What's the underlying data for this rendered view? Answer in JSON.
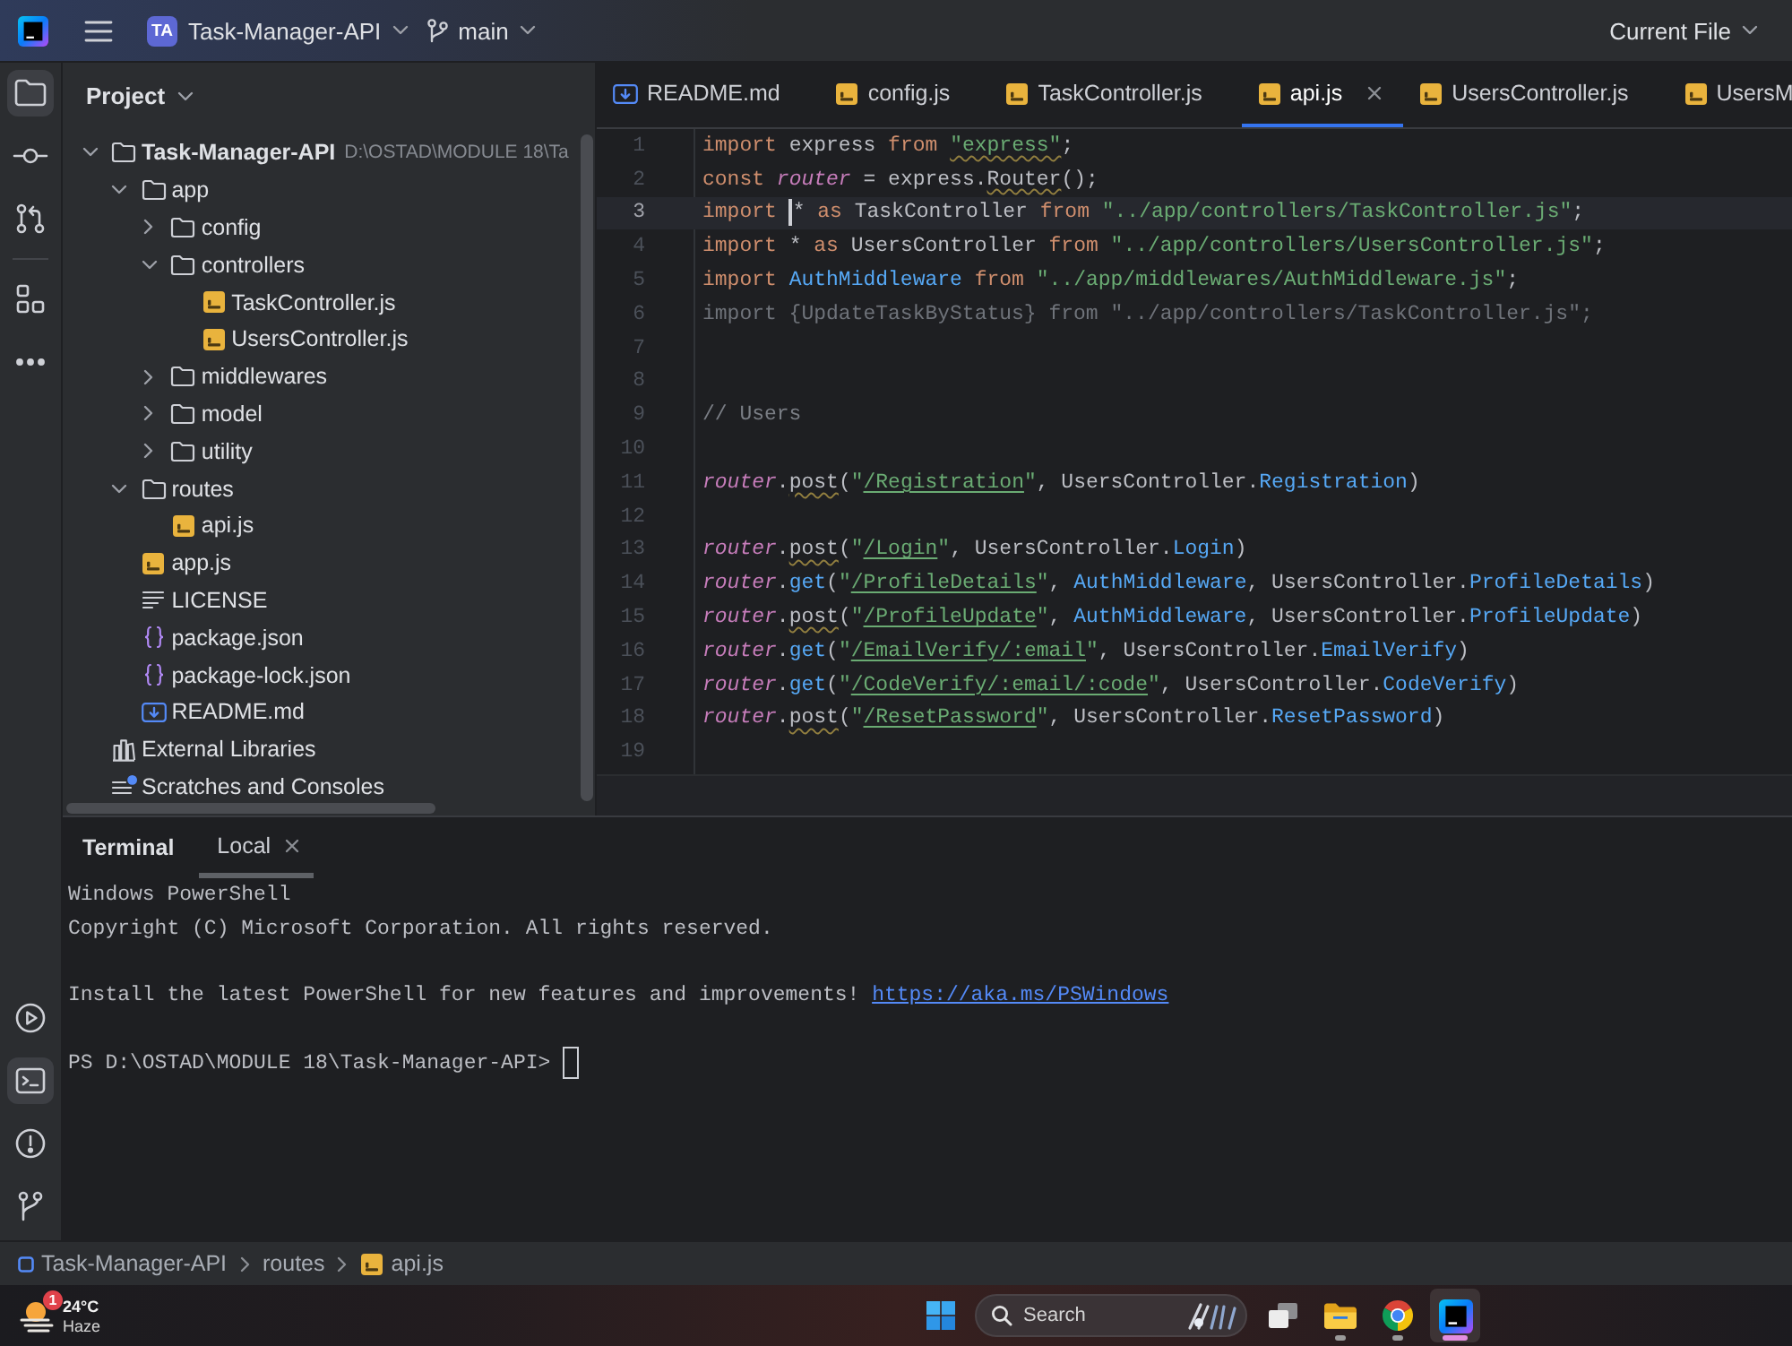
{
  "title_bar": {
    "project_badge": "TA",
    "project": "Task-Manager-API",
    "branch": "main",
    "run_config": "Current File"
  },
  "tool_strip": {
    "top_groups": [
      {
        "buttons": [
          {
            "kind": "project",
            "selected": true
          },
          {
            "kind": "commit",
            "selected": false
          },
          {
            "kind": "pull_requests",
            "selected": false
          }
        ]
      },
      {
        "buttons": [
          {
            "kind": "structure",
            "selected": false
          },
          {
            "kind": "more",
            "selected": false
          }
        ]
      }
    ],
    "bottom": [
      {
        "kind": "services",
        "selected": false
      },
      {
        "kind": "terminal",
        "selected": true
      },
      {
        "kind": "problems",
        "selected": false
      },
      {
        "kind": "git",
        "selected": false
      }
    ]
  },
  "project_panel": {
    "title": "Project",
    "tree": [
      {
        "name": "Task-Manager-API",
        "kind": "project",
        "path": "D:\\OSTAD\\MODULE 18\\Ta",
        "expanded": true,
        "children": [
          {
            "name": "app",
            "kind": "folder",
            "expanded": true,
            "children": [
              {
                "name": "config",
                "kind": "folder",
                "expanded": false
              },
              {
                "name": "controllers",
                "kind": "folder",
                "expanded": true,
                "children": [
                  {
                    "name": "TaskController.js",
                    "kind": "js"
                  },
                  {
                    "name": "UsersController.js",
                    "kind": "js"
                  }
                ]
              },
              {
                "name": "middlewares",
                "kind": "folder",
                "expanded": false
              },
              {
                "name": "model",
                "kind": "folder",
                "expanded": false
              },
              {
                "name": "utility",
                "kind": "folder",
                "expanded": false
              }
            ]
          },
          {
            "name": "routes",
            "kind": "folder",
            "expanded": true,
            "children": [
              {
                "name": "api.js",
                "kind": "js"
              }
            ]
          },
          {
            "name": "app.js",
            "kind": "js"
          },
          {
            "name": "LICENSE",
            "kind": "text"
          },
          {
            "name": "package.json",
            "kind": "json"
          },
          {
            "name": "package-lock.json",
            "kind": "json"
          },
          {
            "name": "README.md",
            "kind": "markdown"
          }
        ]
      },
      {
        "name": "External Libraries",
        "kind": "libraries"
      },
      {
        "name": "Scratches and Consoles",
        "kind": "scratches"
      }
    ]
  },
  "editor": {
    "tabs": [
      {
        "label": "README.md",
        "kind": "markdown",
        "selected": false
      },
      {
        "label": "config.js",
        "kind": "js",
        "selected": false
      },
      {
        "label": "TaskController.js",
        "kind": "js",
        "selected": false
      },
      {
        "label": "api.js",
        "kind": "js",
        "selected": true
      },
      {
        "label": "UsersController.js",
        "kind": "js",
        "selected": false
      },
      {
        "label": "UsersM",
        "kind": "js",
        "selected": false
      }
    ],
    "lines": [
      {
        "number": "1",
        "current": false,
        "tokens": [
          {
            "text": "import",
            "kind": "keyword",
            "typo": false
          },
          {
            "text": " express ",
            "kind": "plain",
            "typo": false
          },
          {
            "text": "from ",
            "kind": "keyword",
            "typo": false
          },
          {
            "text": "\"express\"",
            "kind": "string",
            "typo": true
          },
          {
            "text": ";",
            "kind": "plain",
            "typo": false
          }
        ]
      },
      {
        "number": "2",
        "current": false,
        "tokens": [
          {
            "text": "const ",
            "kind": "keyword",
            "typo": false
          },
          {
            "text": "router",
            "kind": "field",
            "typo": false
          },
          {
            "text": " = express.",
            "kind": "plain",
            "typo": false
          },
          {
            "text": "Router",
            "kind": "plain",
            "typo": true
          },
          {
            "text": "();",
            "kind": "plain",
            "typo": false
          }
        ]
      },
      {
        "number": "3",
        "current": true,
        "tokens": [
          {
            "text": "import ",
            "kind": "keyword",
            "typo": false
          },
          {
            "kind": "caret"
          },
          {
            "text": "* ",
            "kind": "plain",
            "typo": false
          },
          {
            "text": "as",
            "kind": "keyword",
            "typo": false
          },
          {
            "text": " TaskController ",
            "kind": "plain",
            "typo": false
          },
          {
            "text": "from ",
            "kind": "keyword",
            "typo": false
          },
          {
            "text": "\"../app/controllers/TaskController.js\"",
            "kind": "string",
            "typo": false
          },
          {
            "text": ";",
            "kind": "plain",
            "typo": false
          }
        ]
      },
      {
        "number": "4",
        "current": false,
        "tokens": [
          {
            "text": "import",
            "kind": "keyword",
            "typo": false
          },
          {
            "text": " * ",
            "kind": "plain",
            "typo": false
          },
          {
            "text": "as",
            "kind": "keyword",
            "typo": false
          },
          {
            "text": " UsersController ",
            "kind": "plain",
            "typo": false
          },
          {
            "text": "from ",
            "kind": "keyword",
            "typo": false
          },
          {
            "text": "\"../app/controllers/UsersController.js\"",
            "kind": "string",
            "typo": false
          },
          {
            "text": ";",
            "kind": "plain",
            "typo": false
          }
        ]
      },
      {
        "number": "5",
        "current": false,
        "tokens": [
          {
            "text": "import ",
            "kind": "keyword",
            "typo": false
          },
          {
            "text": "AuthMiddleware",
            "kind": "member",
            "typo": false
          },
          {
            "text": " from ",
            "kind": "keyword",
            "typo": false
          },
          {
            "text": "\"../app/middlewares/AuthMiddleware.js\"",
            "kind": "string",
            "typo": false
          },
          {
            "text": ";",
            "kind": "plain",
            "typo": false
          }
        ]
      },
      {
        "number": "6",
        "current": false,
        "tokens": [
          {
            "text": "import {UpdateTaskByStatus} from \"../app/controllers/TaskController.js\";",
            "kind": "unused",
            "typo": false
          }
        ]
      },
      {
        "number": "7",
        "current": false
      },
      {
        "number": "8",
        "current": false
      },
      {
        "number": "9",
        "current": false,
        "tokens": [
          {
            "text": "// Users",
            "kind": "comment",
            "typo": false
          }
        ]
      },
      {
        "number": "10",
        "current": false
      },
      {
        "number": "11",
        "current": false,
        "tokens": [
          {
            "text": "router",
            "kind": "field",
            "typo": false
          },
          {
            "text": ".",
            "kind": "plain",
            "typo": false
          },
          {
            "text": "post",
            "kind": "plain",
            "typo": true
          },
          {
            "text": "(",
            "kind": "plain",
            "typo": false
          },
          {
            "text": "\"",
            "kind": "string",
            "typo": false
          },
          {
            "text": "/Registration",
            "kind": "route",
            "typo": false
          },
          {
            "text": "\"",
            "kind": "string",
            "typo": false
          },
          {
            "text": ", UsersController.",
            "kind": "plain",
            "typo": false
          },
          {
            "text": "Registration",
            "kind": "member",
            "typo": false
          },
          {
            "text": ")",
            "kind": "plain",
            "typo": false
          }
        ]
      },
      {
        "number": "12",
        "current": false
      },
      {
        "number": "13",
        "current": false,
        "tokens": [
          {
            "text": "router",
            "kind": "field",
            "typo": false
          },
          {
            "text": ".",
            "kind": "plain",
            "typo": false
          },
          {
            "text": "post",
            "kind": "plain",
            "typo": true
          },
          {
            "text": "(",
            "kind": "plain",
            "typo": false
          },
          {
            "text": "\"",
            "kind": "string",
            "typo": false
          },
          {
            "text": "/Login",
            "kind": "route",
            "typo": false
          },
          {
            "text": "\"",
            "kind": "string",
            "typo": false
          },
          {
            "text": ", UsersController.",
            "kind": "plain",
            "typo": false
          },
          {
            "text": "Login",
            "kind": "member",
            "typo": false
          },
          {
            "text": ")",
            "kind": "plain",
            "typo": false
          }
        ]
      },
      {
        "number": "14",
        "current": false,
        "tokens": [
          {
            "text": "router",
            "kind": "field",
            "typo": false
          },
          {
            "text": ".",
            "kind": "plain",
            "typo": false
          },
          {
            "text": "get",
            "kind": "member",
            "typo": false
          },
          {
            "text": "(",
            "kind": "plain",
            "typo": false
          },
          {
            "text": "\"",
            "kind": "string",
            "typo": false
          },
          {
            "text": "/ProfileDetails",
            "kind": "route",
            "typo": false
          },
          {
            "text": "\"",
            "kind": "string",
            "typo": false
          },
          {
            "text": ", ",
            "kind": "plain",
            "typo": false
          },
          {
            "text": "AuthMiddleware",
            "kind": "member",
            "typo": false
          },
          {
            "text": ", UsersController.",
            "kind": "plain",
            "typo": false
          },
          {
            "text": "ProfileDetails",
            "kind": "member",
            "typo": false
          },
          {
            "text": ")",
            "kind": "plain",
            "typo": false
          }
        ]
      },
      {
        "number": "15",
        "current": false,
        "tokens": [
          {
            "text": "router",
            "kind": "field",
            "typo": false
          },
          {
            "text": ".",
            "kind": "plain",
            "typo": false
          },
          {
            "text": "post",
            "kind": "plain",
            "typo": true
          },
          {
            "text": "(",
            "kind": "plain",
            "typo": false
          },
          {
            "text": "\"",
            "kind": "string",
            "typo": false
          },
          {
            "text": "/ProfileUpdate",
            "kind": "route",
            "typo": false
          },
          {
            "text": "\"",
            "kind": "string",
            "typo": false
          },
          {
            "text": ", ",
            "kind": "plain",
            "typo": false
          },
          {
            "text": "AuthMiddleware",
            "kind": "member",
            "typo": false
          },
          {
            "text": ", UsersController.",
            "kind": "plain",
            "typo": false
          },
          {
            "text": "ProfileUpdate",
            "kind": "member",
            "typo": false
          },
          {
            "text": ")",
            "kind": "plain",
            "typo": false
          }
        ]
      },
      {
        "number": "16",
        "current": false,
        "tokens": [
          {
            "text": "router",
            "kind": "field",
            "typo": false
          },
          {
            "text": ".",
            "kind": "plain",
            "typo": false
          },
          {
            "text": "get",
            "kind": "member",
            "typo": false
          },
          {
            "text": "(",
            "kind": "plain",
            "typo": false
          },
          {
            "text": "\"",
            "kind": "string",
            "typo": false
          },
          {
            "text": "/EmailVerify/:email",
            "kind": "route",
            "typo": false
          },
          {
            "text": "\"",
            "kind": "string",
            "typo": false
          },
          {
            "text": ", UsersController.",
            "kind": "plain",
            "typo": false
          },
          {
            "text": "EmailVerify",
            "kind": "member",
            "typo": false
          },
          {
            "text": ")",
            "kind": "plain",
            "typo": false
          }
        ]
      },
      {
        "number": "17",
        "current": false,
        "tokens": [
          {
            "text": "router",
            "kind": "field",
            "typo": false
          },
          {
            "text": ".",
            "kind": "plain",
            "typo": false
          },
          {
            "text": "get",
            "kind": "member",
            "typo": false
          },
          {
            "text": "(",
            "kind": "plain",
            "typo": false
          },
          {
            "text": "\"",
            "kind": "string",
            "typo": false
          },
          {
            "text": "/CodeVerify/:email/:code",
            "kind": "route",
            "typo": false
          },
          {
            "text": "\"",
            "kind": "string",
            "typo": false
          },
          {
            "text": ", UsersController.",
            "kind": "plain",
            "typo": false
          },
          {
            "text": "CodeVerify",
            "kind": "member",
            "typo": false
          },
          {
            "text": ")",
            "kind": "plain",
            "typo": false
          }
        ]
      },
      {
        "number": "18",
        "current": false,
        "tokens": [
          {
            "text": "router",
            "kind": "field",
            "typo": false
          },
          {
            "text": ".",
            "kind": "plain",
            "typo": false
          },
          {
            "text": "post",
            "kind": "plain",
            "typo": true
          },
          {
            "text": "(",
            "kind": "plain",
            "typo": false
          },
          {
            "text": "\"",
            "kind": "string",
            "typo": false
          },
          {
            "text": "/ResetPassword",
            "kind": "route",
            "typo": false
          },
          {
            "text": "\"",
            "kind": "string",
            "typo": false
          },
          {
            "text": ", UsersController.",
            "kind": "plain",
            "typo": false
          },
          {
            "text": "ResetPassword",
            "kind": "member",
            "typo": false
          },
          {
            "text": ")",
            "kind": "plain",
            "typo": false
          }
        ]
      },
      {
        "number": "19",
        "current": false
      }
    ]
  },
  "terminal": {
    "title": "Terminal",
    "tabs": [
      {
        "label": "Local",
        "selected": true
      }
    ],
    "lines": [
      {
        "kind": "output",
        "text": "Windows PowerShell"
      },
      {
        "kind": "output",
        "text": "Copyright (C) Microsoft Corporation. All rights reserved."
      },
      {
        "kind": "blank"
      },
      {
        "kind": "output",
        "text": "Install the latest PowerShell for new features and improvements!",
        "link": "https://aka.ms/PSWindows"
      },
      {
        "kind": "blank"
      },
      {
        "kind": "prompt",
        "text": "PS D:\\OSTAD\\MODULE 18\\Task-Manager-API>"
      }
    ]
  },
  "status_bar": {
    "breadcrumbs": [
      {
        "label": "Task-Manager-API",
        "kind": "module"
      },
      {
        "label": "routes",
        "kind": "folder"
      },
      {
        "label": "api.js",
        "kind": "js"
      }
    ]
  },
  "taskbar": {
    "weather": {
      "badge": "1",
      "temperature": "24°C",
      "condition": "Haze"
    },
    "search": {
      "placeholder": "Search"
    },
    "apps": [
      {
        "kind": "task_view",
        "running": false,
        "active": false
      },
      {
        "kind": "file_explorer",
        "running": true,
        "active": false
      },
      {
        "kind": "browser",
        "running": true,
        "active": false
      },
      {
        "kind": "ide",
        "running": true,
        "active": true
      }
    ]
  }
}
